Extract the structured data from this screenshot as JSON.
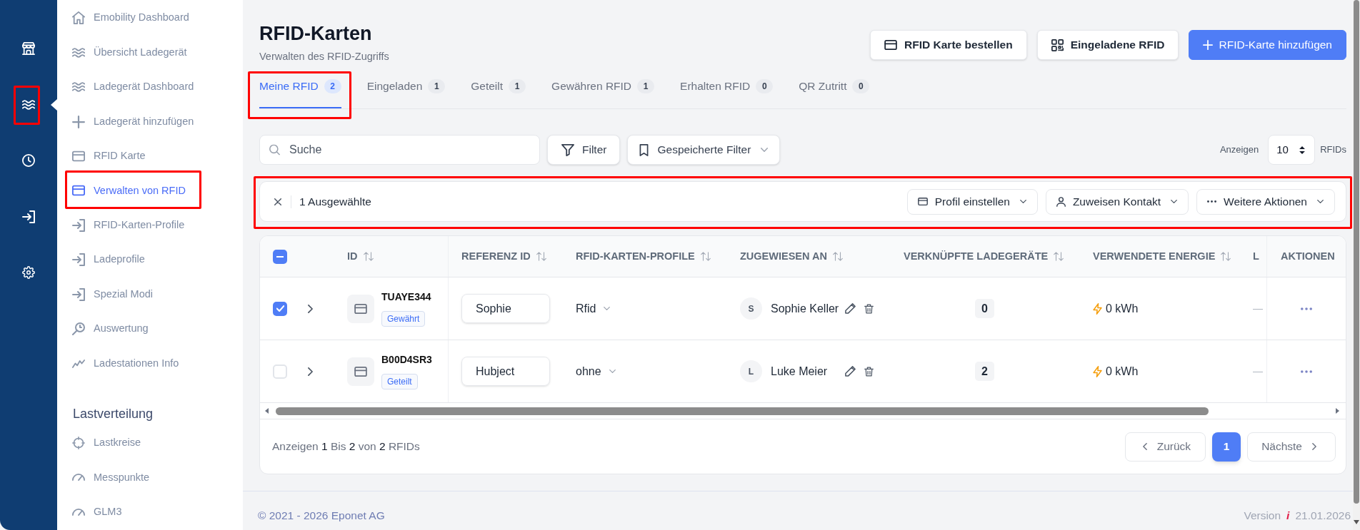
{
  "rail": {
    "items": [
      {
        "selected": false,
        "highlighted": false
      },
      {
        "selected": true,
        "highlighted": true
      },
      {
        "selected": false,
        "highlighted": false
      },
      {
        "selected": false,
        "highlighted": false
      },
      {
        "selected": false,
        "highlighted": false
      }
    ]
  },
  "sidebar": {
    "items": [
      {
        "label": "Emobility Dashboard",
        "selected": false,
        "highlighted": false
      },
      {
        "label": "Übersicht Ladegerät",
        "selected": false,
        "highlighted": false
      },
      {
        "label": "Ladegerät Dashboard",
        "selected": false,
        "highlighted": false
      },
      {
        "label": "Ladegerät hinzufügen",
        "selected": false,
        "highlighted": false
      },
      {
        "label": "RFID Karte",
        "selected": false,
        "highlighted": false
      },
      {
        "label": "Verwalten von RFID",
        "selected": true,
        "highlighted": true
      },
      {
        "label": "RFID-Karten-Profile",
        "selected": false,
        "highlighted": false
      },
      {
        "label": "Ladeprofile",
        "selected": false,
        "highlighted": false
      },
      {
        "label": "Spezial Modi",
        "selected": false,
        "highlighted": false
      },
      {
        "label": "Auswertung",
        "selected": false,
        "highlighted": false
      },
      {
        "label": "Ladestationen Info",
        "selected": false,
        "highlighted": false
      }
    ],
    "sections": [
      {
        "title": "Lastverteilung",
        "items": [
          {
            "label": "Lastkreise",
            "selected": false,
            "highlighted": false
          },
          {
            "label": "Messpunkte",
            "selected": false,
            "highlighted": false
          },
          {
            "label": "GLM3",
            "selected": false,
            "highlighted": false
          }
        ]
      }
    ]
  },
  "header": {
    "title": "RFID-Karten",
    "subtitle": "Verwalten des RFID-Zugriffs",
    "actions": [
      {
        "label": "RFID Karte bestellen",
        "kind": "outline"
      },
      {
        "label": "Eingeladene RFID",
        "kind": "outline"
      },
      {
        "label": "RFID-Karte hinzufügen",
        "kind": "primary"
      }
    ]
  },
  "tabs": [
    {
      "label": "Meine RFID",
      "count": "2",
      "selected": true,
      "highlighted": true
    },
    {
      "label": "Eingeladen",
      "count": "1",
      "selected": false,
      "highlighted": false
    },
    {
      "label": "Geteilt",
      "count": "1",
      "selected": false,
      "highlighted": false
    },
    {
      "label": "Gewähren RFID",
      "count": "1",
      "selected": false,
      "highlighted": false
    },
    {
      "label": "Erhalten RFID",
      "count": "0",
      "selected": false,
      "highlighted": false
    },
    {
      "label": "QR Zutritt",
      "count": "0",
      "selected": false,
      "highlighted": false
    }
  ],
  "toolbar": {
    "search": {
      "placeholder": "Suche"
    },
    "filter_button": "Filter",
    "saved_filters_button": "Gespeicherte Filter",
    "page_size": {
      "label": "Anzeigen",
      "value": "10",
      "unit": "RFIDs"
    }
  },
  "selection_bar": {
    "highlighted": true,
    "count_label": "1 Ausgewählte",
    "actions": [
      "Profil einstellen",
      "Zuweisen Kontakt",
      "Weitere Aktionen"
    ]
  },
  "table": {
    "select_all": {
      "indeterminate": true
    },
    "columns": [
      {
        "label": "ID",
        "sortable": true
      },
      {
        "label": "REFERENZ ID",
        "sortable": true
      },
      {
        "label": "RFID-KARTEN-PROFILE",
        "sortable": true
      },
      {
        "label": "ZUGEWIESEN AN",
        "sortable": true
      },
      {
        "label": "VERKNÜPFTE LADEGERÄTE",
        "sortable": true
      },
      {
        "label": "VERWENDETE ENERGIE",
        "sortable": true
      },
      {
        "label": "L",
        "sortable": false
      },
      {
        "label": "AKTIONEN",
        "sortable": false
      }
    ],
    "rows": [
      {
        "checked": true,
        "id": "TUAYE344",
        "status": "Gewährt",
        "reference": "Sophie",
        "profile": "Rfid",
        "assignee_initial": "S",
        "assignee": "Sophie Keller",
        "linked_chargers": "0",
        "energy": "0 kWh",
        "column_8": "—"
      },
      {
        "checked": false,
        "id": "B00D4SR3",
        "status": "Geteilt",
        "reference": "Hubject",
        "profile": "ohne",
        "assignee_initial": "L",
        "assignee": "Luke Meier",
        "linked_chargers": "2",
        "energy": "0 kWh",
        "column_8": "—"
      }
    ]
  },
  "pagination": {
    "summary": "Anzeigen **1** Bis **2** von **2** RFIDs",
    "previous": "Zurück",
    "pages": [
      {
        "label": "1",
        "selected": true
      }
    ],
    "next": "Nächste"
  },
  "footer": {
    "copyright": "© 2021 - 2026 Eponet AG",
    "version_label": "Version",
    "version_mark": "i",
    "version_date": "21.01.2026"
  }
}
